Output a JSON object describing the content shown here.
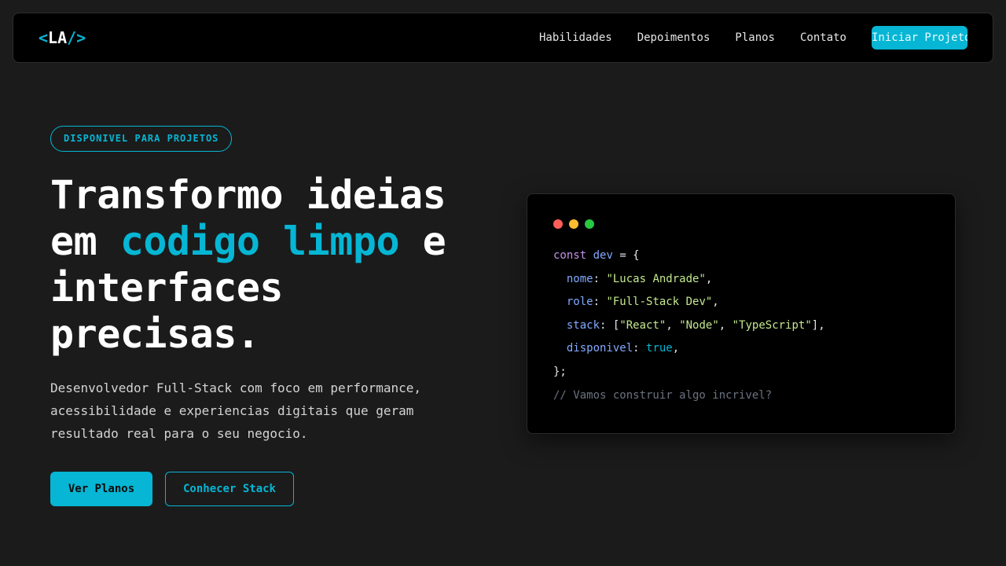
{
  "nav": {
    "logo": {
      "open": "<",
      "text": "LA",
      "close": "/>"
    },
    "links": [
      "Habilidades",
      "Depoimentos",
      "Planos",
      "Contato"
    ],
    "cta": "Iniciar Projeto"
  },
  "hero": {
    "badge": "DISPONIVEL PARA PROJETOS",
    "headline": {
      "part1": "Transformo ideias",
      "part2": "em ",
      "accent": "codigo limpo",
      "part3": " e",
      "part4": "interfaces",
      "part5": "precisas."
    },
    "subtitle": "Desenvolvedor Full-Stack com foco em performance, acessibilidade e experiencias digitais que geram resultado real para o seu negocio.",
    "primary_button": "Ver Planos",
    "secondary_button": "Conhecer Stack"
  },
  "code": {
    "dot_colors": [
      "#ff5f57",
      "#febc2e",
      "#28c840"
    ],
    "keyword": "const",
    "var_name": "dev",
    "open": " = {",
    "props": [
      {
        "key": "nome",
        "value": "\"Lucas Andrade\""
      },
      {
        "key": "role",
        "value": "\"Full-Stack Dev\""
      }
    ],
    "stack_key": "stack",
    "stack_items": [
      "\"React\"",
      "\"Node\"",
      "\"TypeScript\""
    ],
    "available_key": "disponivel",
    "available_value": "true",
    "close": "};",
    "comment": "// Vamos construir algo incrivel?"
  },
  "colors": {
    "accent": "#06b6d4",
    "background": "#1b1b1b",
    "surface": "#000000"
  }
}
